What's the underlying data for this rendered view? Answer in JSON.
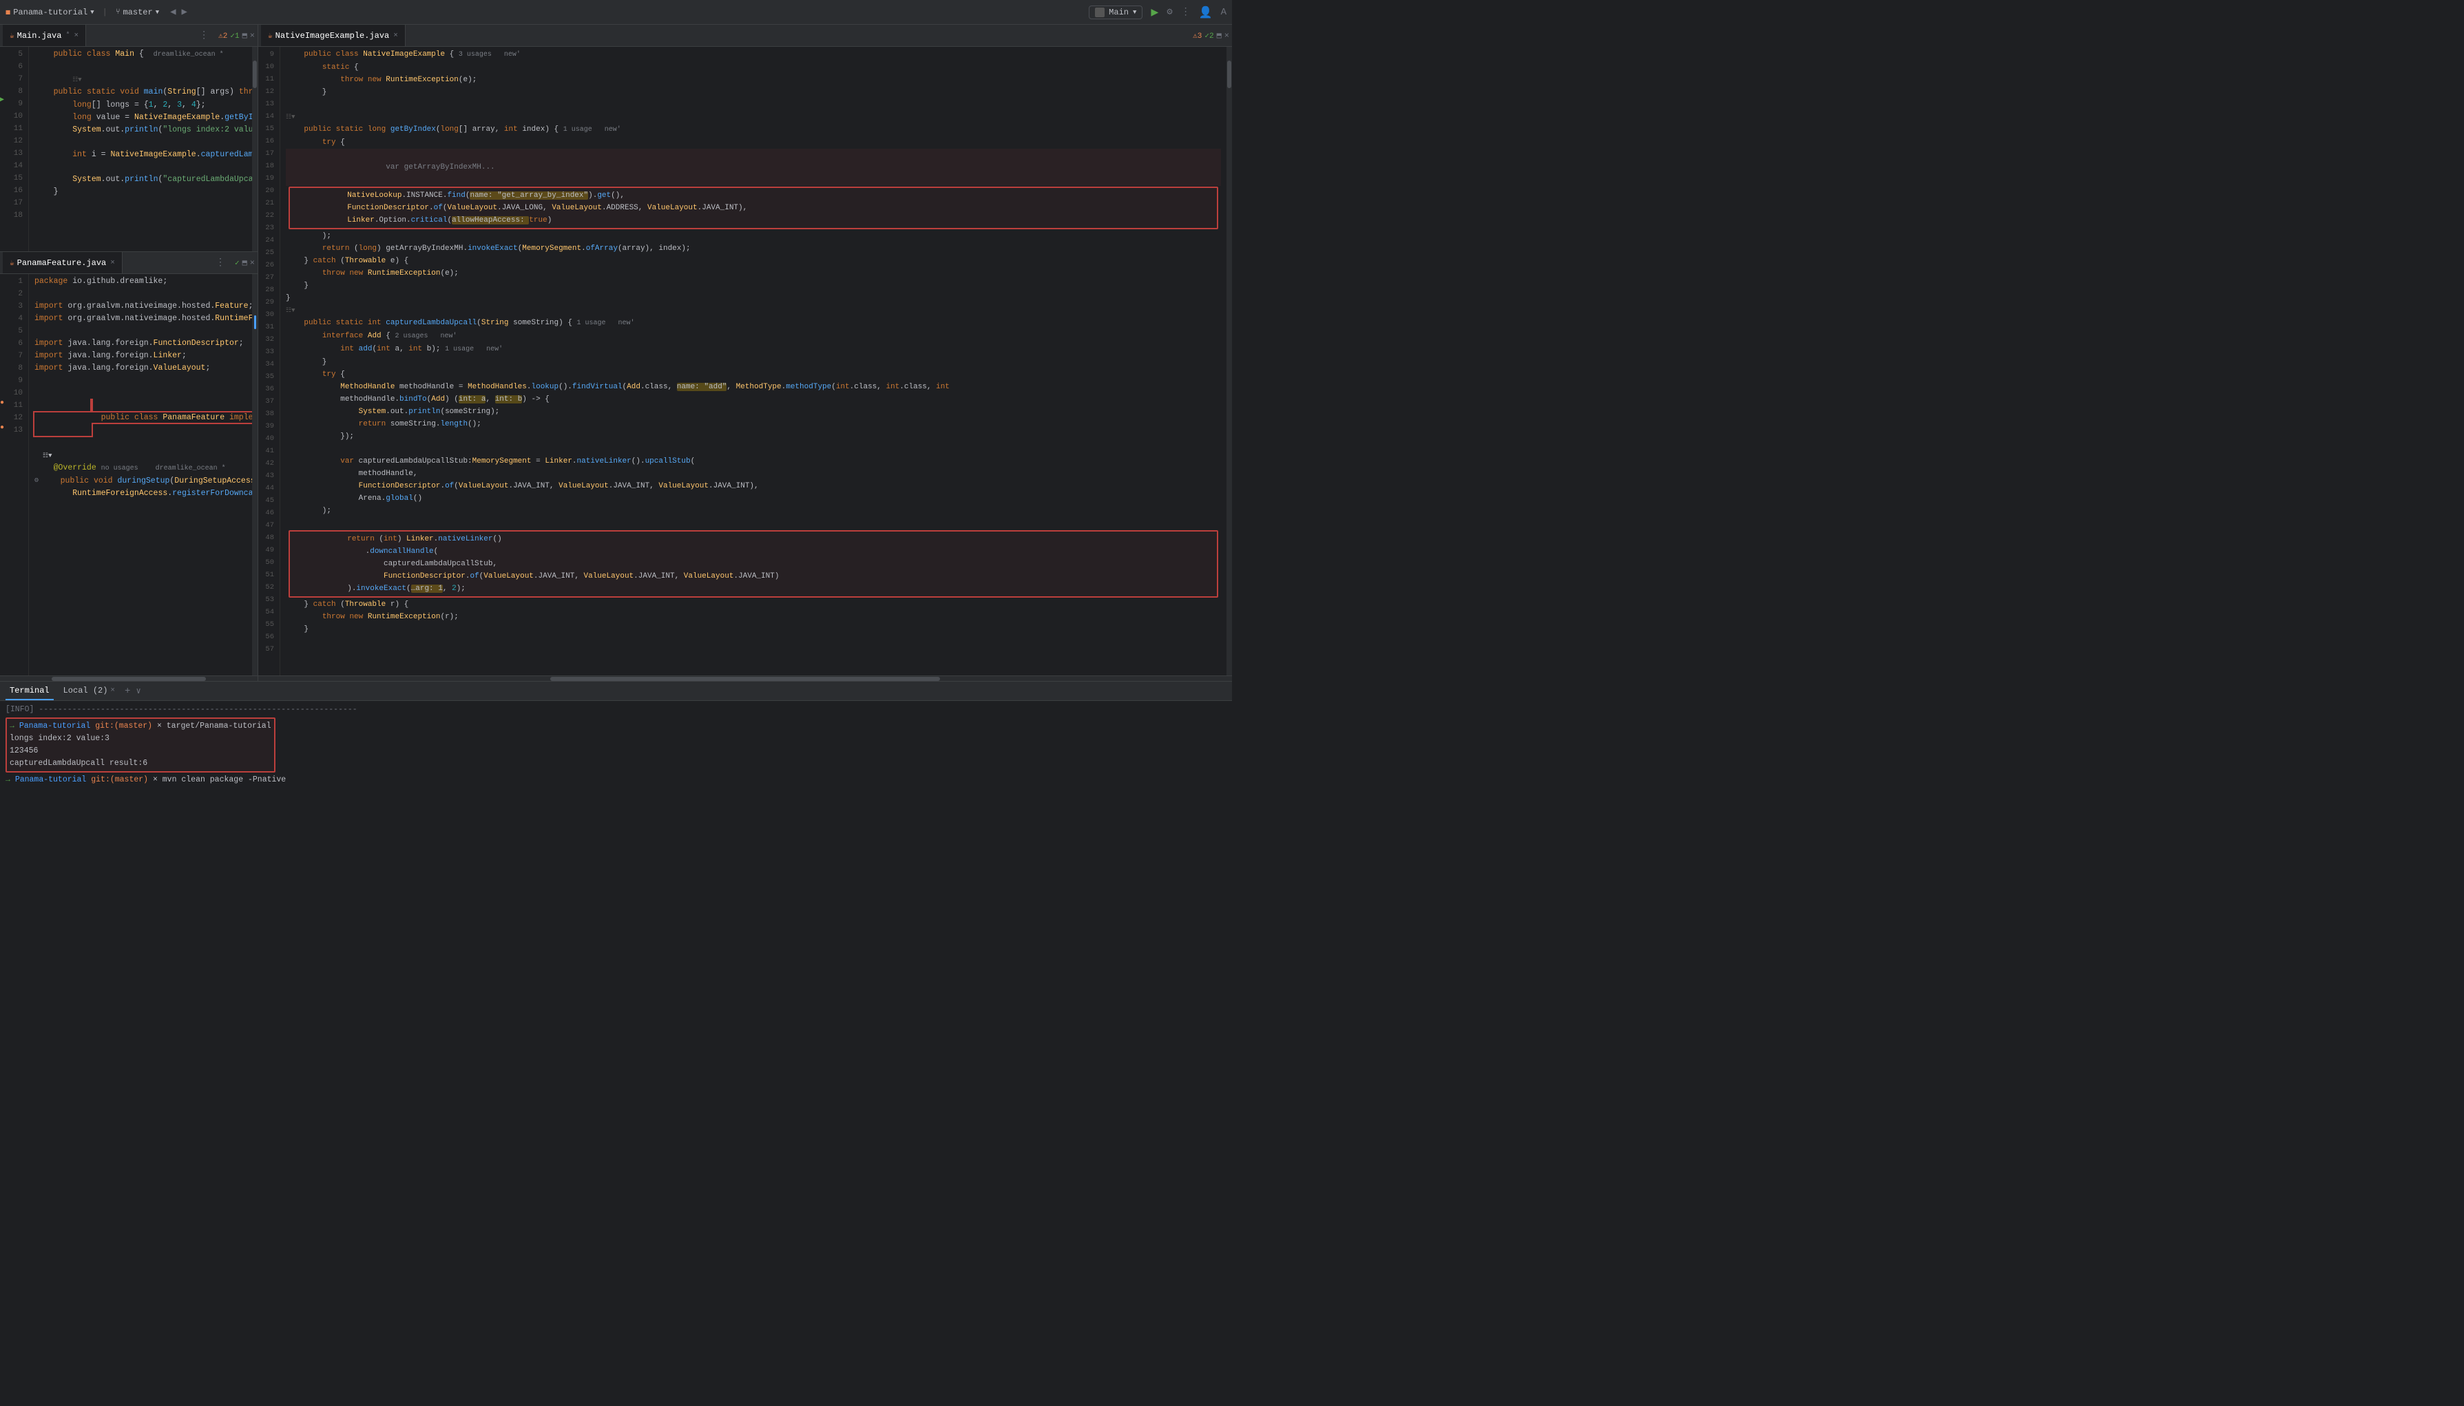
{
  "titlebar": {
    "project": "Panama-tutorial",
    "branch": "master",
    "back_icon": "◀",
    "forward_icon": "▶",
    "run_config": "Main",
    "run_label": "▶",
    "gear_label": "⚙",
    "more_label": "⋮",
    "avatar_label": "👤",
    "translate_label": "A"
  },
  "left_editor": {
    "top_tab": {
      "name": "Main.java",
      "icon": "☕",
      "close": "×",
      "more": "⋮",
      "warn_count": "2",
      "ok_count": "1"
    },
    "bottom_tab": {
      "name": "PanamaFeature.java",
      "icon": "☕",
      "close": "×",
      "more": "⋮",
      "ok_icon": "✓"
    }
  },
  "right_editor": {
    "tab": {
      "name": "NativeImageExample.java",
      "icon": "☕",
      "close": "×",
      "warn_count": "3",
      "ok_count": "2"
    }
  },
  "terminal": {
    "tab_label": "Terminal",
    "local_label": "Local (2)",
    "close": "×",
    "add": "+",
    "dropdown": "∨",
    "lines": [
      "[INFO] -------------------------------------------------------------------",
      "→ Panama-tutorial git:(master) × target/Panama-tutorial",
      "longs index:2 value:3",
      "123456",
      "capturedLambdaUpcall result:6",
      "→ Panama-tutorial git:(master) × mvn clean package -Pnative"
    ]
  }
}
